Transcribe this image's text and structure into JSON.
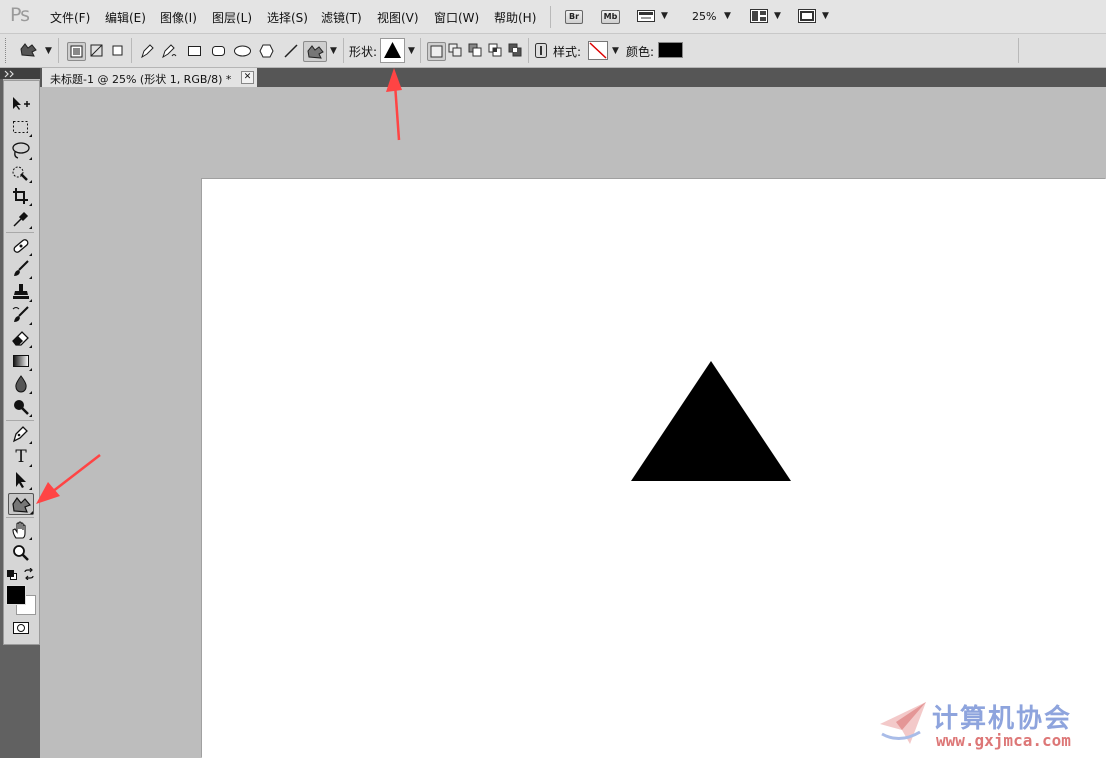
{
  "app": {
    "logo": "Ps"
  },
  "menu": {
    "items": [
      "文件(F)",
      "编辑(E)",
      "图像(I)",
      "图层(L)",
      "选择(S)",
      "滤镜(T)",
      "视图(V)",
      "窗口(W)",
      "帮助(H)"
    ],
    "bridge_label": "Br",
    "minibridge_label": "Mb",
    "zoom": "25%"
  },
  "options": {
    "shape_label": "形状:",
    "style_label": "样式:",
    "color_label": "颜色:",
    "color_value": "#000000"
  },
  "document": {
    "tab_title": "未标题-1 @ 25% (形状 1, RGB/8) *",
    "close_glyph": "✕",
    "canvas_color": "#ffffff",
    "shape": "triangle",
    "shape_color": "#000000"
  },
  "toolbar": {
    "text_tool_glyph": "T",
    "foreground_color": "#000000",
    "background_color": "#ffffff",
    "active_tool": "custom-shape-tool"
  },
  "annotations": {
    "arrow_color": "#ff4444"
  },
  "watermark": {
    "title": "计算机协会",
    "url": "www.gxjmca.com"
  }
}
